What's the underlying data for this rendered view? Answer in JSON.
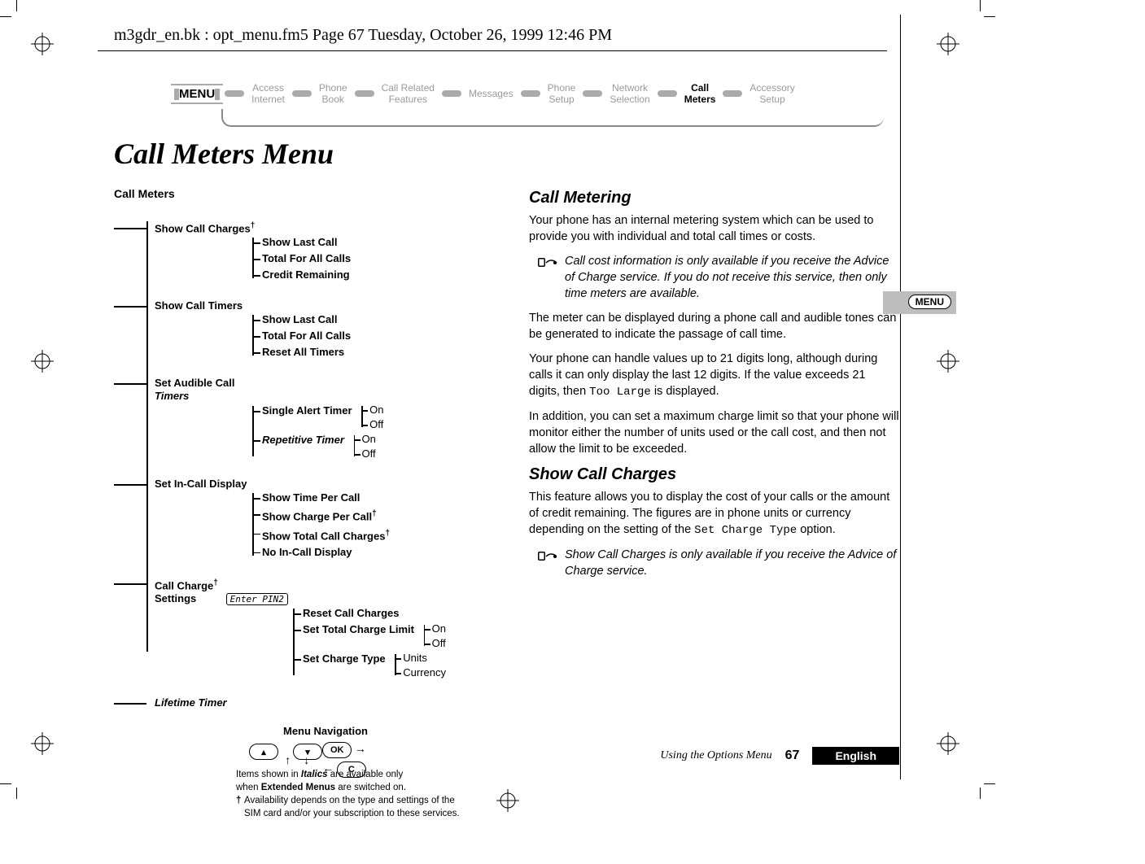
{
  "running_head": "m3gdr_en.bk : opt_menu.fm5  Page 67  Tuesday, October 26, 1999  12:46 PM",
  "nav": {
    "menu_label": "MENU",
    "items": [
      {
        "top": "Access",
        "bot": "Internet",
        "active": false
      },
      {
        "top": "Phone",
        "bot": "Book",
        "active": false
      },
      {
        "top": "Call Related",
        "bot": "Features",
        "active": false
      },
      {
        "top": "Messages",
        "bot": "",
        "active": false
      },
      {
        "top": "Phone",
        "bot": "Setup",
        "active": false
      },
      {
        "top": "Network",
        "bot": "Selection",
        "active": false
      },
      {
        "top": "Call",
        "bot": "Meters",
        "active": true
      },
      {
        "top": "Accessory",
        "bot": "Setup",
        "active": false
      }
    ]
  },
  "title": "Call Meters Menu",
  "diagram": {
    "root": "Call Meters",
    "show_call_charges": {
      "label": "Show Call Charges",
      "children": [
        "Show Last Call",
        "Total For All Calls",
        "Credit Remaining"
      ]
    },
    "show_call_timers": {
      "label": "Show Call Timers",
      "children": [
        "Show Last Call",
        "Total For All Calls",
        "Reset All Timers"
      ]
    },
    "audible": {
      "label_top": "Set Audible Call",
      "label_bot": "Timers",
      "single": "Single Alert Timer",
      "repetitive": "Repetitive Timer",
      "on": "On",
      "off": "Off"
    },
    "incall": {
      "label": "Set In-Call Display",
      "children": [
        "Show Time Per Call",
        "Show Charge Per Call",
        "Show Total Call Charges",
        "No In-Call Display"
      ]
    },
    "charge_settings": {
      "label_top": "Call Charge",
      "label_bot": "Settings",
      "pin": "Enter PIN2",
      "reset": "Reset Call Charges",
      "limit": "Set Total Charge Limit",
      "type": "Set Charge Type",
      "on": "On",
      "off": "Off",
      "units": "Units",
      "currency": "Currency"
    },
    "lifetime": "Lifetime Timer",
    "nav_title": "Menu Navigation",
    "ok": "OK",
    "c": "C",
    "note1a": "Items shown in ",
    "note1b": "Italics",
    "note1c": " are available only",
    "note2a": "when ",
    "note2b": "Extended Menus",
    "note2c": " are switched on.",
    "note3": "Availability depends on the type and settings of the",
    "note4": "SIM card and/or your subscription to these services."
  },
  "col2": {
    "h_metering": "Call Metering",
    "p1": "Your phone has an internal metering system which can be used to provide you with individual and total call times or costs.",
    "note1": "Call cost information is only available if you receive the Advice of Charge service. If you do not receive this service, then only time meters are available.",
    "p2": "The meter can be displayed during a phone call and audible tones can be generated to indicate the passage of call time.",
    "p3a": "Your phone can handle values up to 21 digits long, although during calls it can only display the last 12 digits. If the value exceeds 21 digits, then ",
    "p3_mono": "Too Large",
    "p3b": " is displayed.",
    "p4": "In addition, you can set a maximum charge limit so that your phone will monitor either the number of units used or the call cost, and then not allow the limit to be exceeded.",
    "h_showcharges": "Show Call Charges",
    "p5a": "This feature allows you to display the cost of your calls or the amount of credit remaining. The figures are in phone units or currency depending on the setting of the ",
    "p5_mono": "Set Charge Type",
    "p5b": " option.",
    "note2": "Show Call Charges is only available if you receive the Advice of Charge service."
  },
  "side_menu_label": "MENU",
  "footer": {
    "section": "Using the Options Menu",
    "page": "67",
    "lang": "English"
  }
}
